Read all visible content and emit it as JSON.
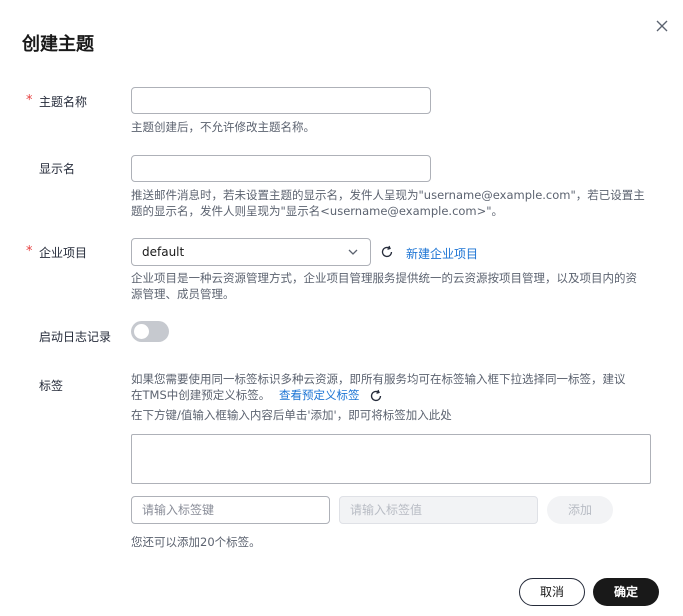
{
  "dialog": {
    "title": "创建主题"
  },
  "topic_name": {
    "label": "主题名称",
    "required_mark": "*",
    "value": "",
    "hint": "主题创建后，不允许修改主题名称。"
  },
  "display_name": {
    "label": "显示名",
    "value": "",
    "hint_line1": "推送邮件消息时，若未设置主题的显示名，发件人呈现为\"username@example.com\"，若已设置主",
    "hint_line2": "题的显示名，发件人则呈现为\"显示名<username@example.com>\"。"
  },
  "enterprise_project": {
    "label": "企业项目",
    "required_mark": "*",
    "selected": "default",
    "new_link": "新建企业项目",
    "hint_line1": "企业项目是一种云资源管理方式，企业项目管理服务提供统一的云资源按项目管理，以及项目内的资",
    "hint_line2": "源管理、成员管理。"
  },
  "log": {
    "label": "启动日志记录",
    "enabled": false
  },
  "tags": {
    "label": "标签",
    "hint_line1": "如果您需要使用同一标签标识多种云资源，即所有服务均可在标签输入框下拉选择同一标签，建议",
    "hint_line2": "在TMS中创建预定义标签。",
    "predefined_link": "查看预定义标签",
    "hint_line3": "在下方键/值输入框输入内容后单击'添加'，即可将标签加入此处",
    "key_placeholder": "请输入标签键",
    "value_placeholder": "请输入标签值",
    "add_label": "添加",
    "remaining": "您还可以添加20个标签。"
  },
  "footer": {
    "cancel_label": "取消",
    "ok_label": "确定"
  },
  "icons": {
    "close": "close-icon",
    "chevron": "chevron-down-icon",
    "refresh": "refresh-icon"
  },
  "colors": {
    "required": "#e63e3e",
    "link": "#1c74d4",
    "primary_button": "#191919"
  }
}
